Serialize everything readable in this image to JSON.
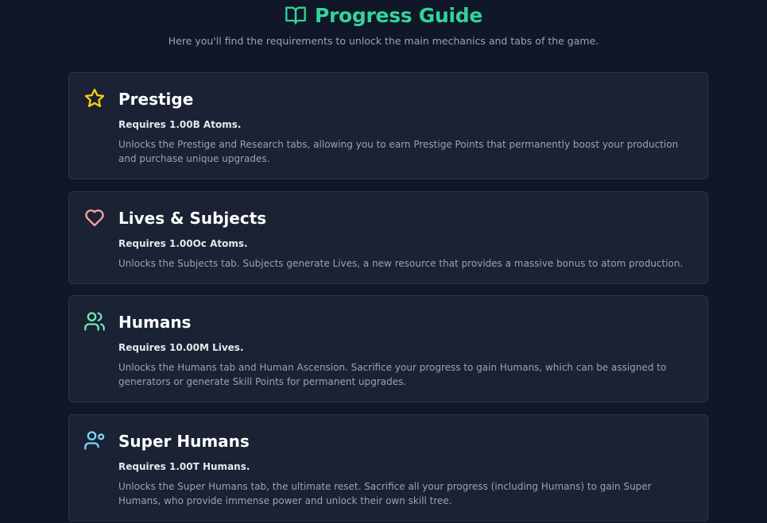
{
  "header": {
    "title": "Progress Guide",
    "subtitle": "Here you'll find the requirements to unlock the main mechanics and tabs of the game."
  },
  "colors": {
    "background": "#0f1729",
    "card_background": "#1a2233",
    "accent_green": "#34d399",
    "prestige_icon": "#facc15",
    "lives_icon": "#fca5a5",
    "humans_icon": "#6ee7b7",
    "super_humans_icon": "#7dd3fc"
  },
  "guides": [
    {
      "title": "Prestige",
      "icon": "star-icon",
      "requirement": "Requires 1.00B Atoms.",
      "description": "Unlocks the Prestige and Research tabs, allowing you to earn Prestige Points that permanently boost your production and purchase unique upgrades."
    },
    {
      "title": "Lives & Subjects",
      "icon": "heart-icon",
      "requirement": "Requires 1.00Oc Atoms.",
      "description": "Unlocks the Subjects tab. Subjects generate Lives, a new resource that provides a massive bonus to atom production."
    },
    {
      "title": "Humans",
      "icon": "users-icon",
      "requirement": "Requires 10.00M Lives.",
      "description": "Unlocks the Humans tab and Human Ascension. Sacrifice your progress to gain Humans, which can be assigned to generators or generate Skill Points for permanent upgrades."
    },
    {
      "title": "Super Humans",
      "icon": "user-cog-icon",
      "requirement": "Requires 1.00T Humans.",
      "description": "Unlocks the Super Humans tab, the ultimate reset. Sacrifice all your progress (including Humans) to gain Super Humans, who provide immense power and unlock their own skill tree."
    }
  ]
}
